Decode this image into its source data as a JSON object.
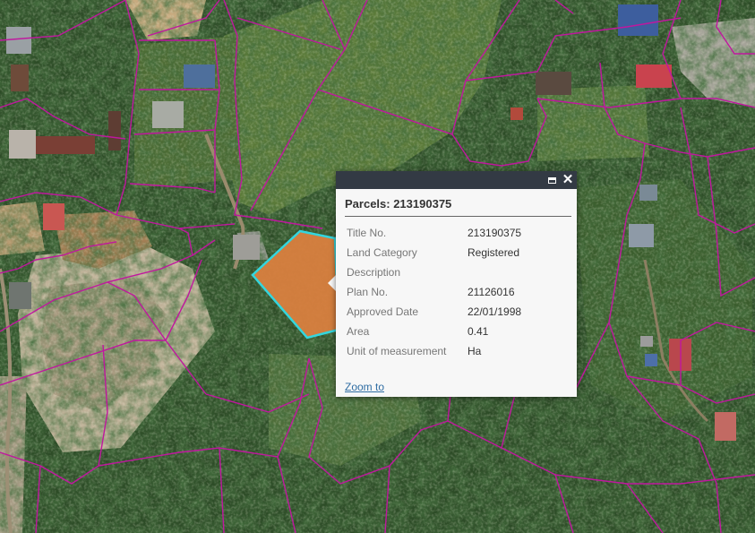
{
  "map": {
    "layer": "Parcels",
    "selected_fill": "#d9803f",
    "selected_outline": "#33d6de",
    "parcel_line_color": "#c0179f"
  },
  "popup": {
    "title": "Parcels: 213190375",
    "maximize_icon": "maximize-icon",
    "close_icon": "close-icon",
    "close_glyph": "✕",
    "attributes": [
      {
        "label": "Title No.",
        "value": "213190375"
      },
      {
        "label": "Land Category",
        "value": "Registered"
      },
      {
        "label": "Description",
        "value": ""
      },
      {
        "label": "Plan No.",
        "value": "21126016"
      },
      {
        "label": "Approved Date",
        "value": "22/01/1998"
      },
      {
        "label": "Area",
        "value": "0.41"
      },
      {
        "label": "Unit of measurement",
        "value": "Ha"
      }
    ],
    "zoom_link": "Zoom to"
  }
}
